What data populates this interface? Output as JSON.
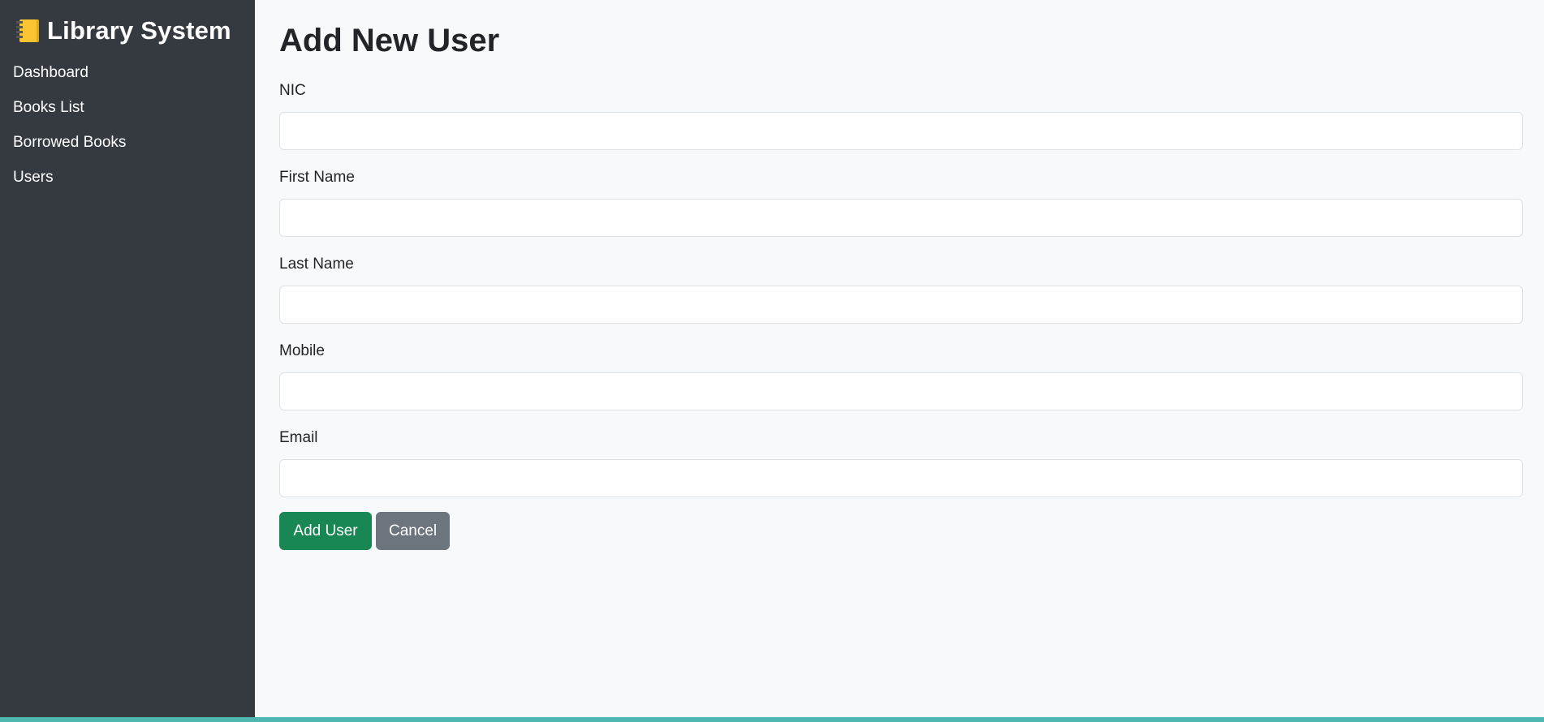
{
  "brand": {
    "icon": "notebook-icon",
    "title": "Library System"
  },
  "sidebar": {
    "items": [
      {
        "label": "Dashboard"
      },
      {
        "label": "Books List"
      },
      {
        "label": "Borrowed Books"
      },
      {
        "label": "Users"
      }
    ]
  },
  "main": {
    "title": "Add New User",
    "fields": [
      {
        "label": "NIC",
        "value": ""
      },
      {
        "label": "First Name",
        "value": ""
      },
      {
        "label": "Last Name",
        "value": ""
      },
      {
        "label": "Mobile",
        "value": ""
      },
      {
        "label": "Email",
        "value": ""
      }
    ],
    "buttons": {
      "add_label": "Add User",
      "cancel_label": "Cancel"
    }
  },
  "colors": {
    "sidebar_bg": "#343a40",
    "main_bg": "#f8f9fa",
    "success": "#198754",
    "secondary": "#6c757d"
  }
}
